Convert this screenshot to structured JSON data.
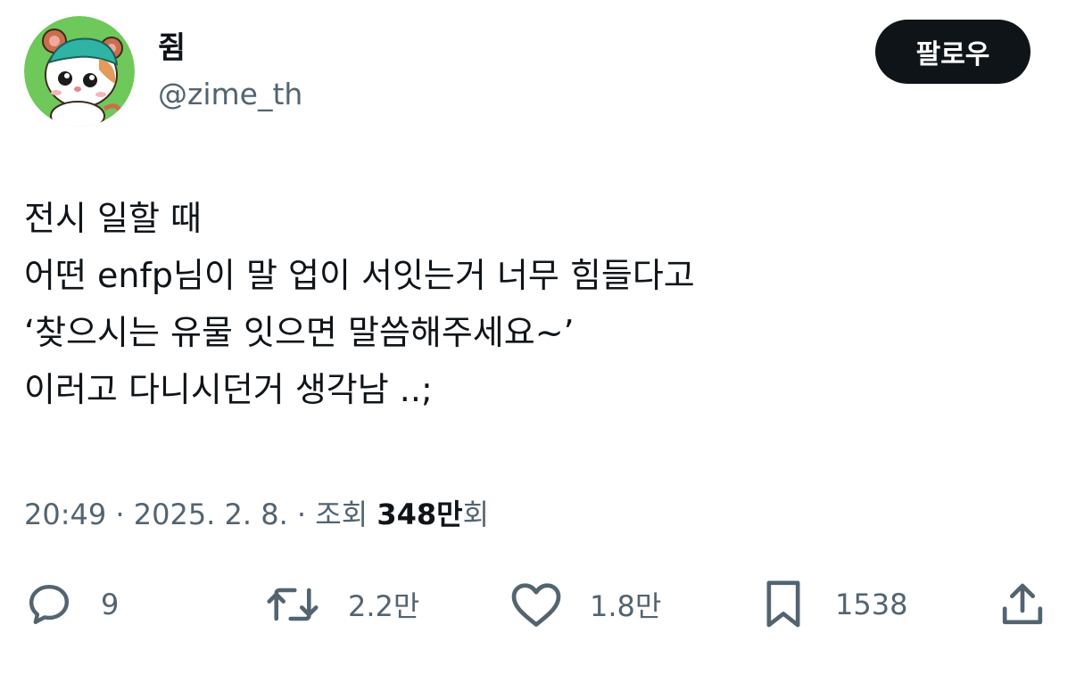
{
  "author": {
    "display_name": "쥠",
    "handle": "@zime_th",
    "avatar_icon": "hamster-avatar"
  },
  "follow_button": {
    "label": "팔로우"
  },
  "tweet": {
    "lines": [
      "전시 일할 때",
      "어떤 enfp님이 말 업이 서잇는거 너무 힘들다고",
      "‘찾으시는 유물 잇으면 말씀해주세요~’",
      "이러고 다니시던거 생각남 ..;"
    ]
  },
  "meta": {
    "time": "20:49",
    "separator": "·",
    "date": "2025. 2. 8.",
    "views_prefix": "조회",
    "views_count": "348만",
    "views_suffix": "회"
  },
  "actions": {
    "reply": {
      "icon": "reply-icon",
      "count": "9"
    },
    "retweet": {
      "icon": "retweet-icon",
      "count": "2.2만"
    },
    "like": {
      "icon": "heart-icon",
      "count": "1.8만"
    },
    "bookmark": {
      "icon": "bookmark-icon",
      "count": "1538"
    },
    "share": {
      "icon": "share-icon"
    }
  },
  "colors": {
    "text_primary": "#0f1419",
    "text_secondary": "#536471",
    "follow_bg": "#0f1419",
    "avatar_bg": "#6fc85a"
  }
}
